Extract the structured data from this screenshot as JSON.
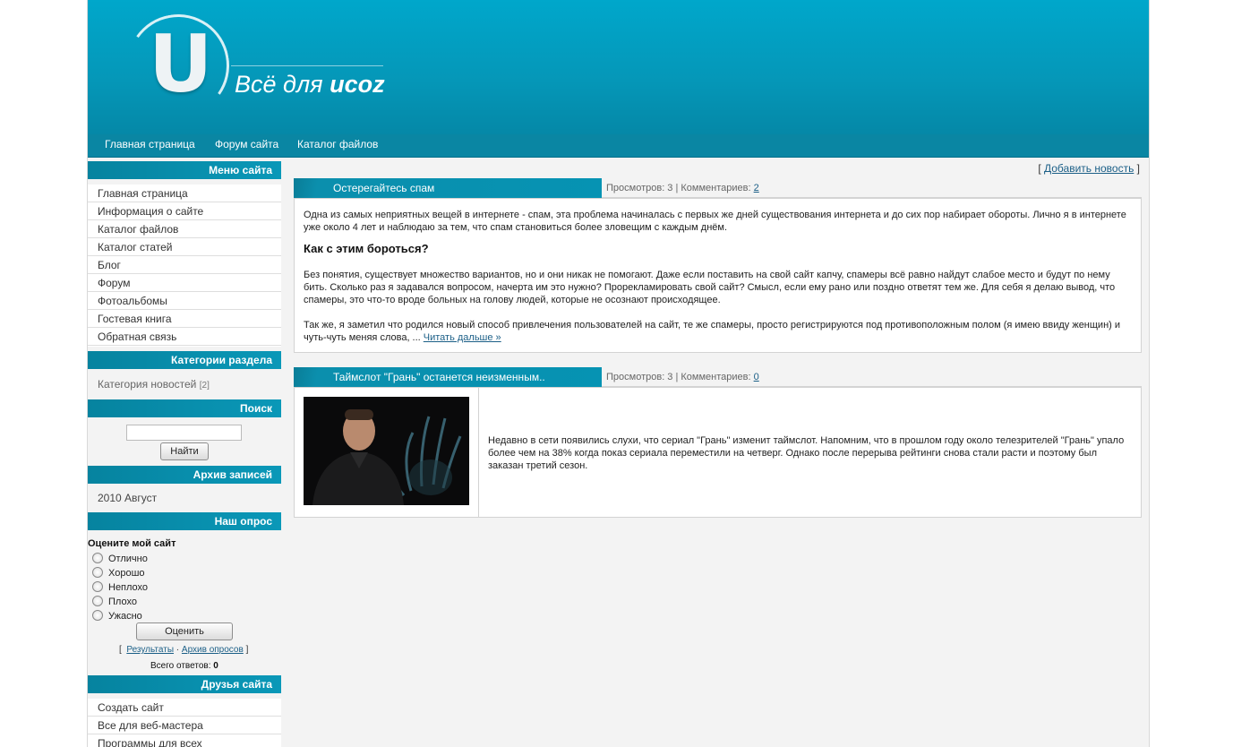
{
  "header": {
    "logo_letter": "U",
    "logo_text_prefix": "Всё для ",
    "logo_text_brand": "ucoz"
  },
  "nav": [
    "Главная страница",
    "Форум сайта",
    "Каталог файлов"
  ],
  "sidebar": {
    "menu_title": "Меню сайта",
    "menu_items": [
      "Главная страница",
      "Информация о сайте",
      "Каталог файлов",
      "Каталог статей",
      "Блог",
      "Форум",
      "Фотоальбомы",
      "Гостевая книга",
      "Обратная связь"
    ],
    "categories_title": "Категории раздела",
    "category_name": "Категория новостей",
    "category_count": "[2]",
    "search_title": "Поиск",
    "search_button": "Найти",
    "archive_title": "Архив записей",
    "archive_item": "2010 Август",
    "poll_title": "Наш опрос",
    "poll_question": "Оцените мой сайт",
    "poll_options": [
      "Отлично",
      "Хорошо",
      "Неплохо",
      "Плохо",
      "Ужасно"
    ],
    "poll_button": "Оценить",
    "poll_results": "Результаты",
    "poll_archive": "Архив опросов",
    "poll_total_label": "Всего ответов:",
    "poll_total_value": "0",
    "friends_title": "Друзья сайта",
    "friends_items": [
      "Создать сайт",
      "Все для веб-мастера",
      "Программы для всех"
    ]
  },
  "content": {
    "add_news": "Добавить новость",
    "posts": [
      {
        "title": "Остерегайтесь спам",
        "views_label": "Просмотров: 3 | Комментариев: ",
        "comments": "2",
        "p1": "Одна из самых неприятных вещей в интернете - спам, эта проблема начиналась с первых же дней существования интернета и до сих пор набирает обороты. Лично я в интернете уже около 4 лет и наблюдаю за тем, что спам становиться более зловещим с каждым днём.",
        "heading": "Как с этим бороться?",
        "p2": "Без понятия, существует множество вариантов, но и они никак не помогают. Даже если поставить на свой сайт капчу, спамеры всё равно найдут слабое место и будут по нему бить. Сколько раз я задавался вопросом, начерта им это нужно? Прорекламировать свой сайт? Смысл, если ему рано или поздно ответят тем же. Для себя я делаю вывод, что спамеры, это что-то вроде больных на голову людей, которые не осознают происходящее.",
        "p3": "Так же, я заметил что родился новый способ привлечения пользователей на сайт, те же спамеры, просто регистрируются под противоположным полом (я имею ввиду женщин) и чуть-чуть меняя слова, ... ",
        "read_more": "Читать дальше »"
      },
      {
        "title": "Таймслот \"Грань\" останется неизменным..",
        "views_label": "Просмотров: 3 | Комментариев: ",
        "comments": "0",
        "text": "Недавно в сети появились слухи, что сериал \"Грань\" изменит таймслот. Напомним, что в прошлом году около телезрителей \"Грань\" упало более чем на 38% когда показ сериала переместили на четверг. Однако после перерыва рейтинги снова стали расти и поэтому был заказан третий сезон."
      }
    ]
  }
}
